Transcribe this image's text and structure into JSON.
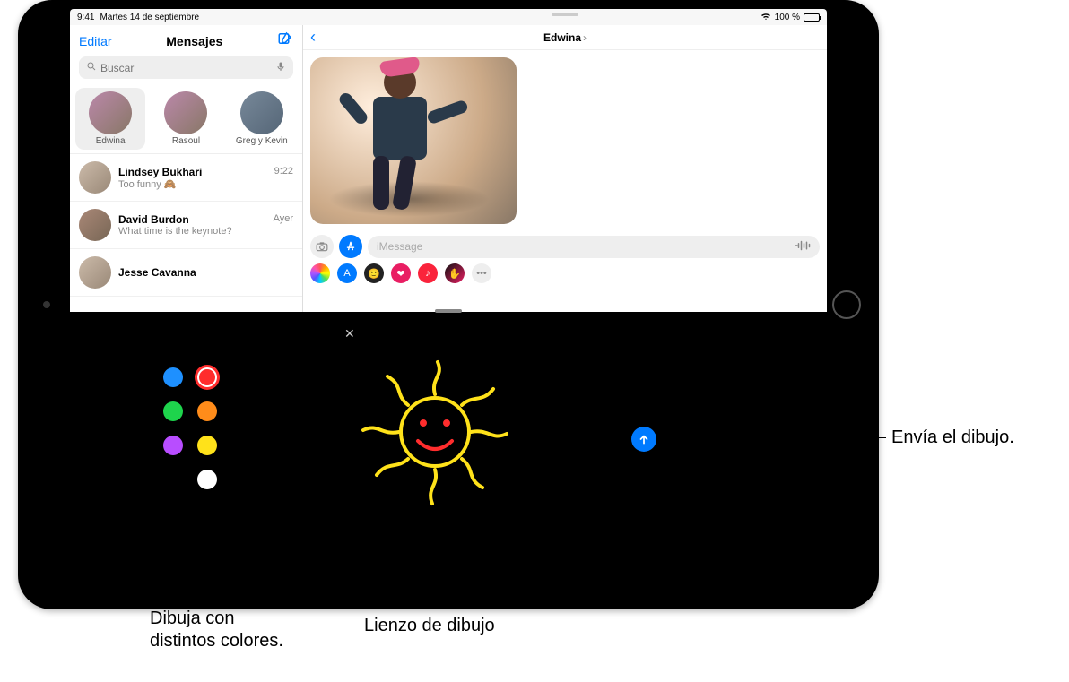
{
  "status": {
    "time": "9:41",
    "date": "Martes 14 de septiembre",
    "battery": "100 %"
  },
  "sidebar": {
    "edit": "Editar",
    "title": "Mensajes",
    "search_placeholder": "Buscar",
    "pinned": [
      {
        "name": "Edwina"
      },
      {
        "name": "Rasoul"
      },
      {
        "name": "Greg y Kevin"
      }
    ],
    "convos": [
      {
        "name": "Lindsey Bukhari",
        "time": "9:22",
        "preview": "Too funny 🙈"
      },
      {
        "name": "David Burdon",
        "time": "Ayer",
        "preview": "What time is the keynote?"
      },
      {
        "name": "Jesse Cavanna",
        "time": "",
        "preview": ""
      }
    ]
  },
  "chat": {
    "contact": "Edwina",
    "placeholder": "iMessage"
  },
  "dt": {
    "colors": {
      "blue": "#1e90ff",
      "red": "#ff2d2d",
      "green": "#1ed44c",
      "orange": "#ff8c1a",
      "purple": "#b84dff",
      "yellow": "#ffe21a",
      "white": "#ffffff"
    },
    "selected": "red"
  },
  "callouts": {
    "send": "Envía el dibujo.",
    "colors_l1": "Dibuja con",
    "colors_l2": "distintos colores.",
    "canvas": "Lienzo de dibujo"
  }
}
